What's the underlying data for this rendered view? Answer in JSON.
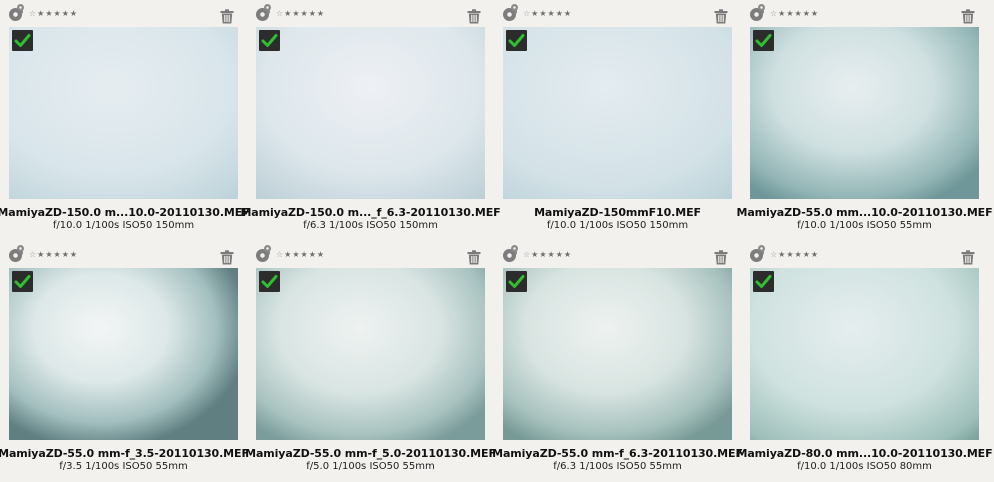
{
  "icons": {
    "settings": "gear-icon",
    "rating": "star-rating",
    "delete": "trash-icon",
    "selected": "checkmark-icon"
  },
  "colors": {
    "background": "#f3f1ee",
    "check_bg": "#2c2c2c",
    "check_mark": "#2fbf2f"
  },
  "rating_glyphs": [
    "☆",
    "★",
    "★",
    "★",
    "★",
    "★"
  ],
  "images": [
    {
      "filename": "MamiyaZD-150.0 m...10.0-20110130.MEF",
      "info": "f/10.0 1/100s ISO50 150mm",
      "selected": true
    },
    {
      "filename": "MamiyaZD-150.0 m..._f_6.3-20110130.MEF",
      "info": "f/6.3 1/100s ISO50 150mm",
      "selected": true
    },
    {
      "filename": "MamiyaZD-150mmF10.MEF",
      "info": "f/10.0 1/100s ISO50 150mm",
      "selected": true
    },
    {
      "filename": "MamiyaZD-55.0 mm...10.0-20110130.MEF",
      "info": "f/10.0 1/100s ISO50 55mm",
      "selected": true
    },
    {
      "filename": "MamiyaZD-55.0 mm-f_3.5-20110130.MEF",
      "info": "f/3.5 1/100s ISO50 55mm",
      "selected": true
    },
    {
      "filename": "MamiyaZD-55.0 mm-f_5.0-20110130.MEF",
      "info": "f/5.0 1/100s ISO50 55mm",
      "selected": true
    },
    {
      "filename": "MamiyaZD-55.0 mm-f_6.3-20110130.MEF",
      "info": "f/6.3 1/100s ISO50 55mm",
      "selected": true
    },
    {
      "filename": "MamiyaZD-80.0 mm...10.0-20110130.MEF",
      "info": "f/10.0 1/100s ISO50 80mm",
      "selected": true
    }
  ]
}
